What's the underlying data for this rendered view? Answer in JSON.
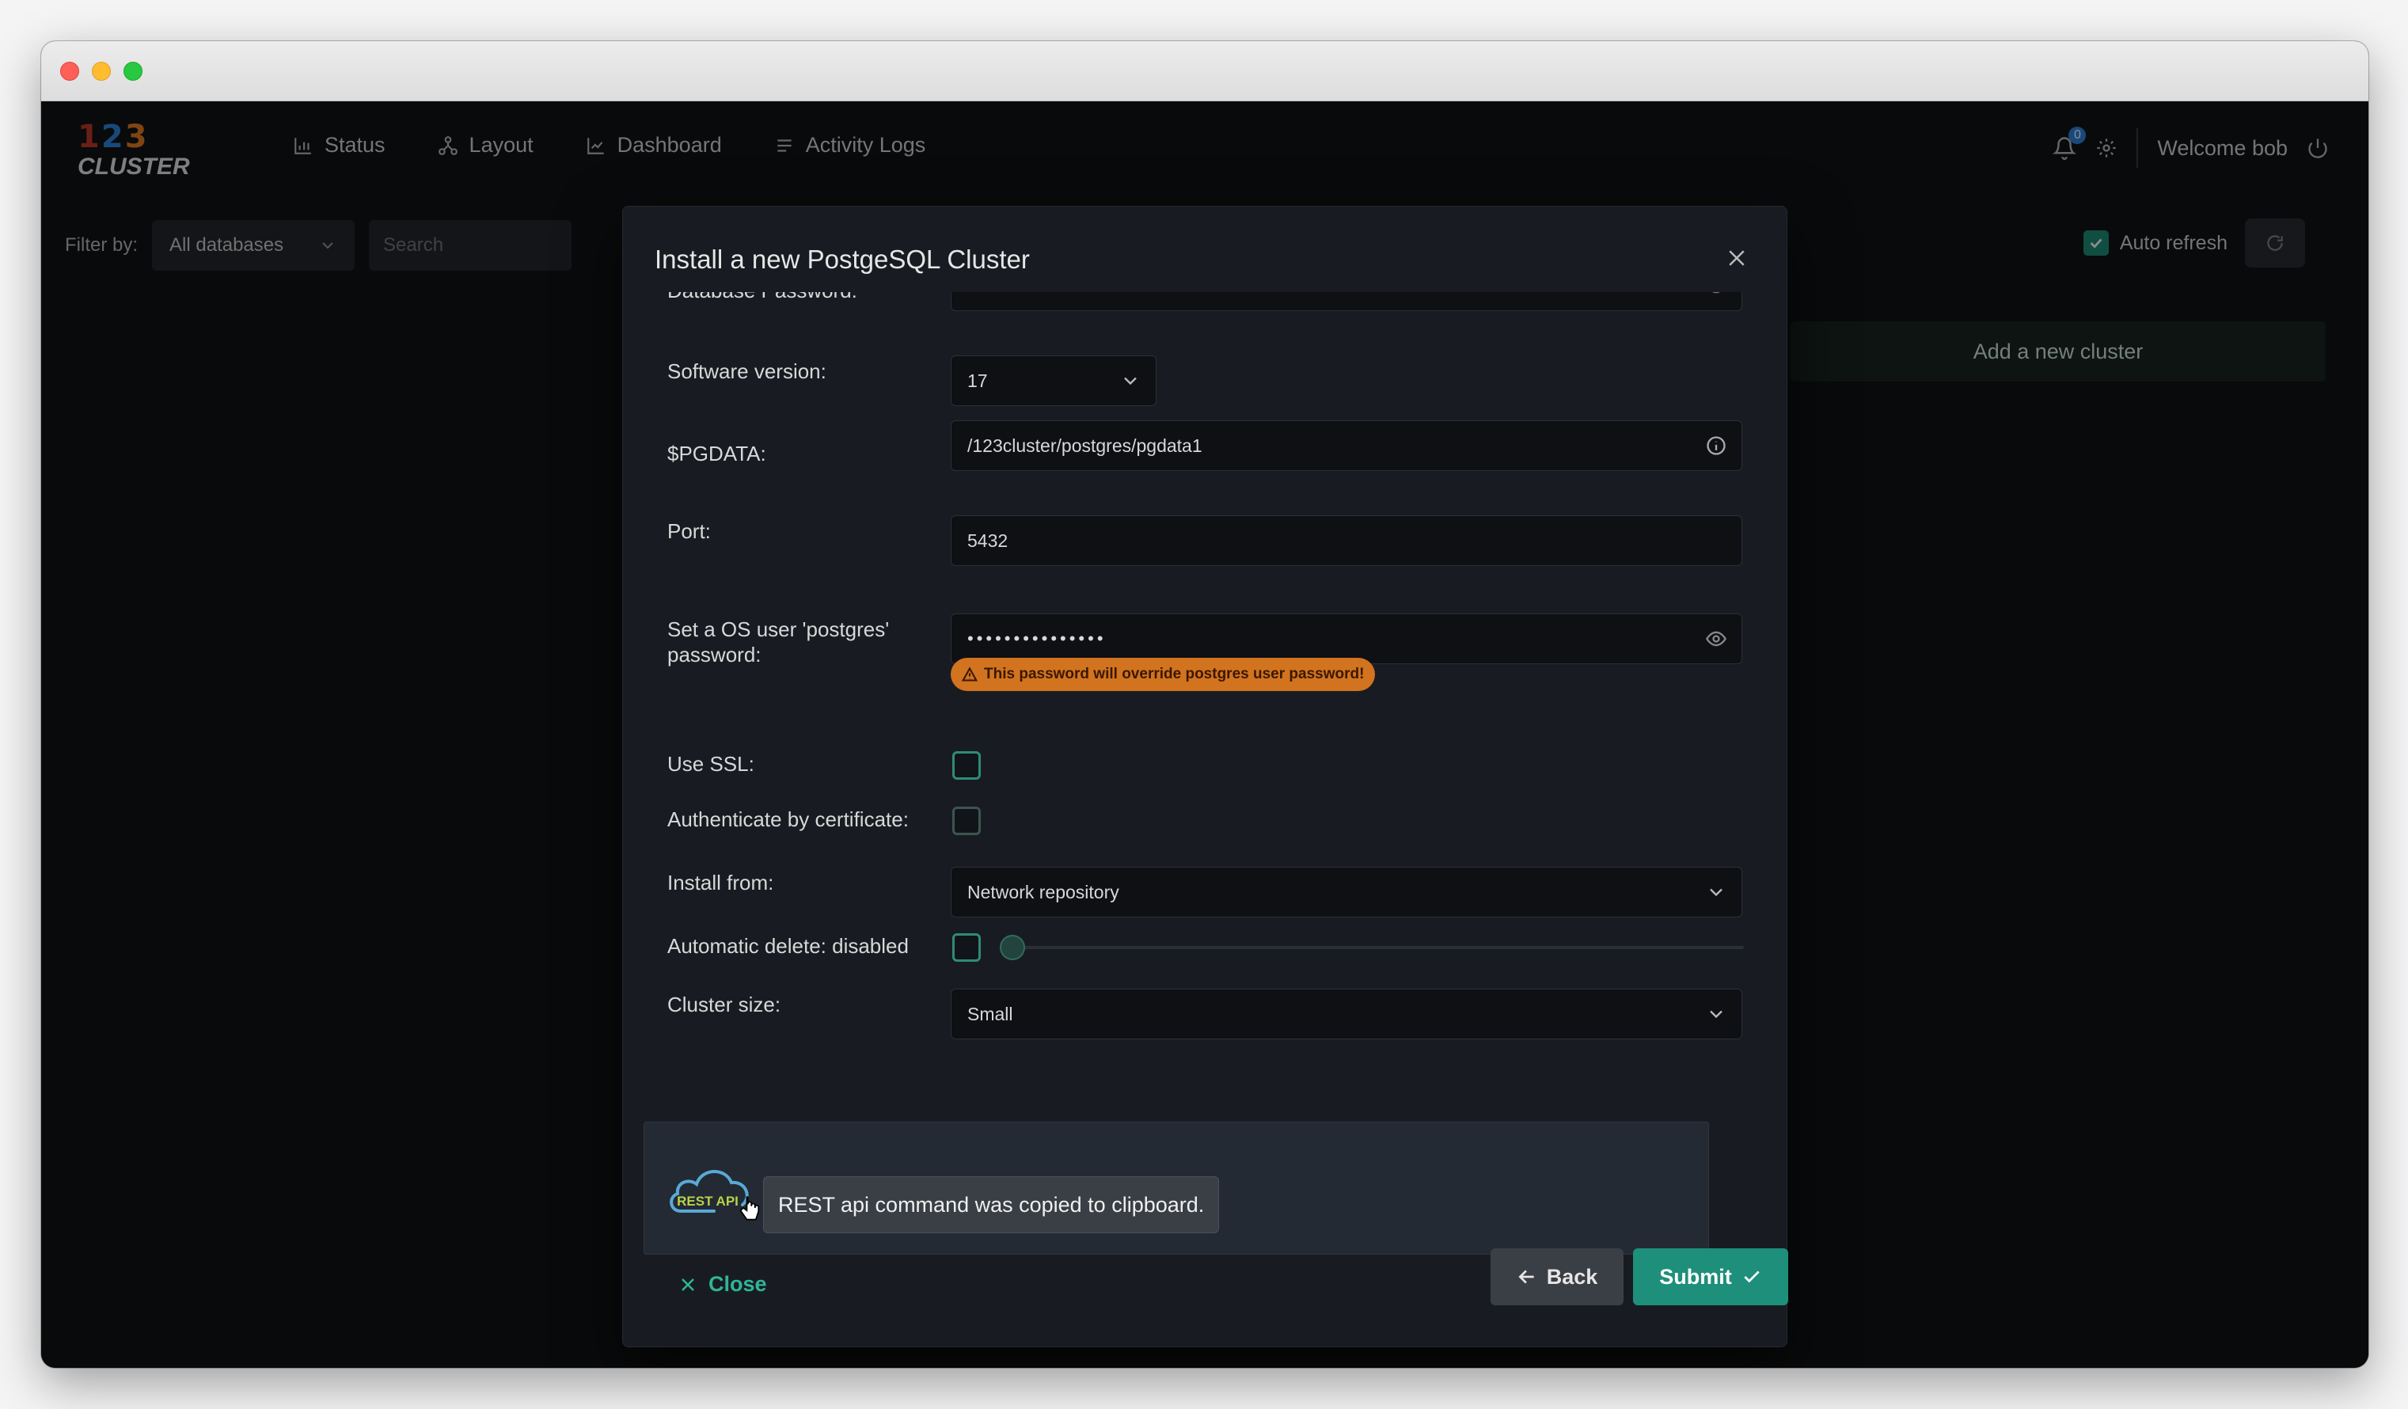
{
  "app": {
    "logo_digits": [
      "1",
      "2",
      "3"
    ],
    "logo_word": "CLUSTER"
  },
  "nav": {
    "items": [
      {
        "label": "Status",
        "icon": "bar-chart-icon"
      },
      {
        "label": "Layout",
        "icon": "layout-nodes-icon"
      },
      {
        "label": "Dashboard",
        "icon": "line-chart-icon"
      },
      {
        "label": "Activity Logs",
        "icon": "list-icon"
      }
    ]
  },
  "header": {
    "notifications_count": "0",
    "welcome": "Welcome bob"
  },
  "filters": {
    "label": "Filter by:",
    "database_select": "All databases",
    "search_placeholder": "Search"
  },
  "toolbar": {
    "auto_refresh_label": "Auto refresh",
    "add_cluster_label": "Add a new cluster"
  },
  "modal": {
    "title": "Install a new PostgeSQL Cluster",
    "fields": {
      "db_password": {
        "label": "Database Password:",
        "value": "•••••••••••••"
      },
      "software_version": {
        "label": "Software version:",
        "value": "17"
      },
      "pgdata": {
        "label": "$PGDATA:",
        "value": "/123cluster/postgres/pgdata1"
      },
      "port": {
        "label": "Port:",
        "value": "5432"
      },
      "os_password": {
        "label": "Set a OS user 'postgres' password:",
        "value": "•••••••••••••••",
        "warning": "This password will override postgres user password!"
      },
      "use_ssl": {
        "label": "Use SSL:",
        "checked": false
      },
      "auth_cert": {
        "label": "Authenticate by certificate:",
        "checked": false
      },
      "install_from": {
        "label": "Install from:",
        "value": "Network repository"
      },
      "auto_delete": {
        "label": "Automatic delete: disabled",
        "checked": false,
        "slider_value": 0
      },
      "cluster_size": {
        "label": "Cluster size:",
        "value": "Small"
      }
    },
    "rest": {
      "icon_text": "REST API",
      "tooltip": "REST api command was copied to clipboard."
    },
    "footer": {
      "close_label": "Close",
      "back_label": "Back",
      "submit_label": "Submit"
    }
  },
  "colors": {
    "accent": "#1e8f7a",
    "warning": "#d2731f",
    "background": "#111315"
  }
}
